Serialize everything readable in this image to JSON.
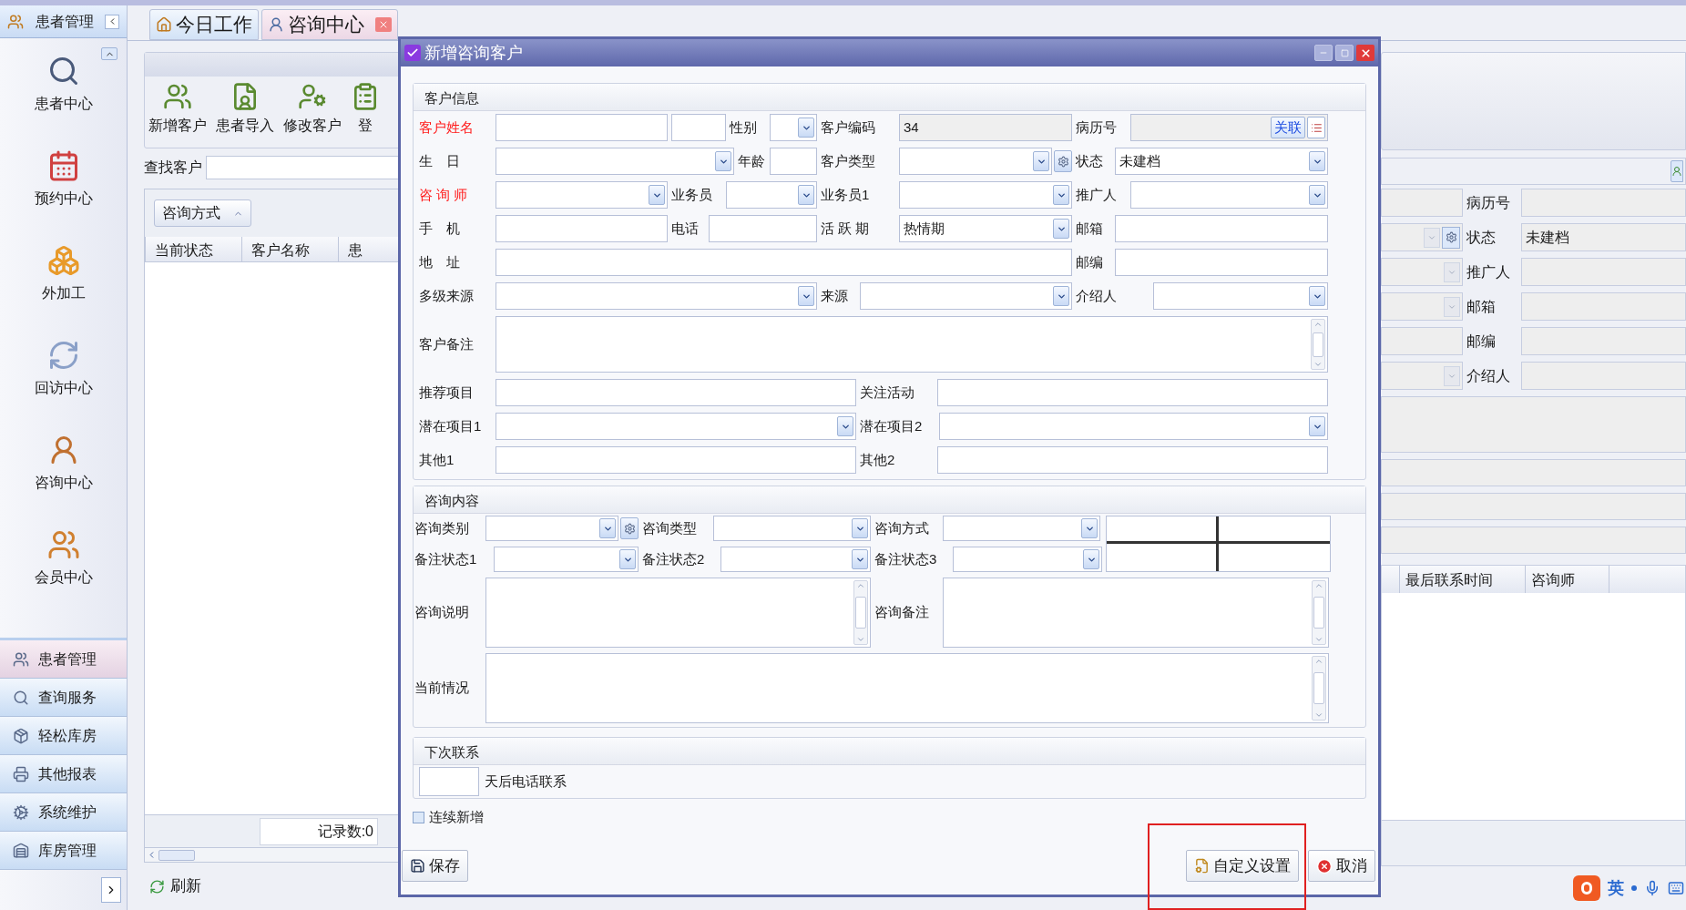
{
  "sidebar": {
    "header": "患者管理",
    "items": [
      {
        "label": "患者中心"
      },
      {
        "label": "预约中心"
      },
      {
        "label": "外加工"
      },
      {
        "label": "回访中心"
      },
      {
        "label": "咨询中心"
      },
      {
        "label": "会员中心"
      }
    ],
    "nav": [
      {
        "label": "患者管理",
        "selected": true
      },
      {
        "label": "查询服务",
        "selected": false
      },
      {
        "label": "轻松库房",
        "selected": false
      },
      {
        "label": "其他报表",
        "selected": false
      },
      {
        "label": "系统维护",
        "selected": false
      },
      {
        "label": "库房管理",
        "selected": false
      }
    ]
  },
  "tabs": [
    {
      "label": "今日工作",
      "selected": false
    },
    {
      "label": "咨询中心",
      "selected": true
    }
  ],
  "toolbar": [
    "新增客户",
    "患者导入",
    "修改客户",
    "登"
  ],
  "search": {
    "label": "查找客户"
  },
  "group_by": "咨询方式",
  "table": {
    "columns": [
      "当前状态",
      "客户名称",
      "患"
    ],
    "record_count": "记录数:0"
  },
  "refresh": "刷新",
  "background_form": {
    "rows": [
      {
        "kind": "text",
        "label": "病历号"
      },
      {
        "kind": "select_gear",
        "label": "状态",
        "value": "未建档"
      },
      {
        "kind": "select",
        "label": "推广人"
      },
      {
        "kind": "select",
        "label": "邮箱"
      },
      {
        "kind": "text",
        "label": "邮编"
      },
      {
        "kind": "select",
        "label": "介绍人"
      }
    ],
    "columns": [
      "最后联系时间",
      "咨询师"
    ]
  },
  "dialog": {
    "title": "新增咨询客户",
    "customer_info": {
      "title": "客户信息",
      "fields": [
        {
          "label": "客户姓名",
          "required": true,
          "kind": "name"
        },
        {
          "label": "性别",
          "required": false,
          "kind": "select"
        },
        {
          "label": "客户编码",
          "required": false,
          "kind": "readonly",
          "value": "34"
        },
        {
          "label": "病历号",
          "required": false,
          "kind": "record",
          "button": "关联"
        },
        {
          "label": "生　日",
          "required": false,
          "kind": "select"
        },
        {
          "label": "年龄",
          "required": false,
          "kind": "text"
        },
        {
          "label": "客户类型",
          "required": false,
          "kind": "select_gear"
        },
        {
          "label": "状态",
          "required": false,
          "kind": "select",
          "value": "未建档"
        },
        {
          "label": "咨 询 师",
          "required": true,
          "kind": "select"
        },
        {
          "label": "业务员",
          "required": false,
          "kind": "select"
        },
        {
          "label": "业务员1",
          "required": false,
          "kind": "select"
        },
        {
          "label": "推广人",
          "required": false,
          "kind": "select"
        },
        {
          "label": "手　机",
          "required": false,
          "kind": "text"
        },
        {
          "label": "电话",
          "required": false,
          "kind": "text"
        },
        {
          "label": "活 跃 期",
          "required": false,
          "kind": "select",
          "value": "热情期"
        },
        {
          "label": "邮箱",
          "required": false,
          "kind": "text"
        },
        {
          "label": "地　址",
          "required": false,
          "kind": "text"
        },
        {
          "label": "邮编",
          "required": false,
          "kind": "text"
        },
        {
          "label": "多级来源",
          "required": false,
          "kind": "select"
        },
        {
          "label": "来源",
          "required": false,
          "kind": "select"
        },
        {
          "label": "介绍人",
          "required": false,
          "kind": "select"
        },
        {
          "label": "客户备注",
          "required": false,
          "kind": "memo"
        },
        {
          "label": "推荐项目",
          "required": false,
          "kind": "text"
        },
        {
          "label": "关注活动",
          "required": false,
          "kind": "text"
        },
        {
          "label": "潜在项目1",
          "required": false,
          "kind": "select"
        },
        {
          "label": "潜在项目2",
          "required": false,
          "kind": "select"
        },
        {
          "label": "其他1",
          "required": false,
          "kind": "text"
        },
        {
          "label": "其他2",
          "required": false,
          "kind": "text"
        }
      ]
    },
    "consult": {
      "title": "咨询内容",
      "fields": [
        {
          "label": "咨询类别",
          "kind": "select_gear"
        },
        {
          "label": "咨询类型",
          "kind": "select"
        },
        {
          "label": "咨询方式",
          "kind": "select"
        },
        {
          "label": "备注状态1",
          "kind": "select"
        },
        {
          "label": "备注状态2",
          "kind": "select"
        },
        {
          "label": "备注状态3",
          "kind": "select"
        },
        {
          "label": "咨询说明",
          "kind": "memo"
        },
        {
          "label": "咨询备注",
          "kind": "memo"
        },
        {
          "label": "当前情况",
          "kind": "memo"
        }
      ]
    },
    "next_contact": {
      "title": "下次联系",
      "suffix": "天后电话联系"
    },
    "continuous": {
      "label": "连续新增",
      "checked": false
    },
    "buttons": [
      {
        "kind": "save",
        "label": "保存"
      },
      {
        "kind": "custom",
        "label": "自定义设置"
      },
      {
        "kind": "cancel",
        "label": "取消"
      }
    ]
  },
  "ime": {
    "label": "英"
  }
}
